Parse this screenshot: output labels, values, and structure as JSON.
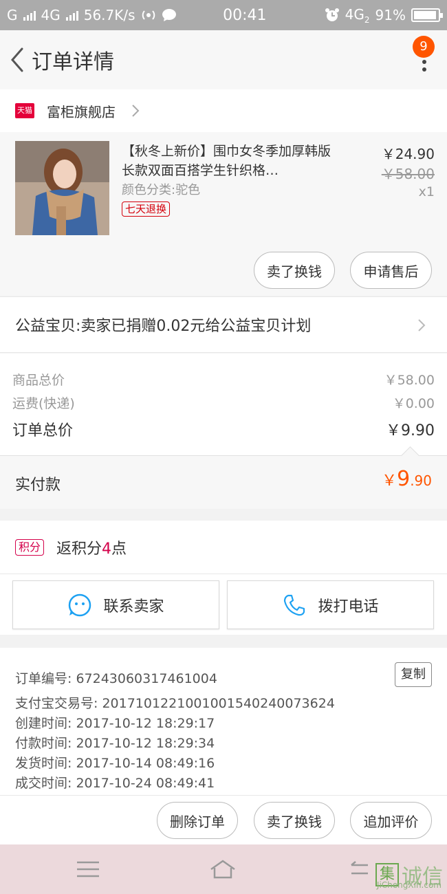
{
  "status_bar": {
    "left": "G",
    "network": "4G",
    "speed": "56.7K/s",
    "time": "00:41",
    "right_network": "4G",
    "right_network_sub": "2",
    "battery": "91%"
  },
  "header": {
    "title": "订单详情",
    "badge": "9"
  },
  "shop": {
    "platform_tag": "天猫",
    "name": "富柜旗舰店"
  },
  "item": {
    "title": "【秋冬上新价】围巾女冬季加厚韩版长款双面百搭学生针织格…",
    "sku": "颜色分类:驼色",
    "tag": "七天退换",
    "price": "￥24.90",
    "original_price": "￥58.00",
    "quantity": "x1",
    "buttons": {
      "sell": "卖了换钱",
      "after_sale": "申请售后"
    }
  },
  "charity": {
    "text": "公益宝贝:卖家已捐赠0.02元给公益宝贝计划"
  },
  "summary": {
    "goods_label": "商品总价",
    "goods_value": "￥58.00",
    "shipping_label": "运费(快递)",
    "shipping_value": "￥0.00",
    "total_label": "订单总价",
    "total_value": "￥9.90",
    "paid_label": "实付款",
    "paid_currency": "￥",
    "paid_int": "9",
    "paid_dec": ".90"
  },
  "points": {
    "tag": "积分",
    "prefix": "返积分",
    "num": "4",
    "suffix": "点"
  },
  "contact": {
    "seller": "联系卖家",
    "phone": "拨打电话"
  },
  "order_info": {
    "order_no": "订单编号: 67243060317461004",
    "alipay_no": "支付宝交易号: 2017101221001001540240073624",
    "created": "创建时间: 2017-10-12 18:29:17",
    "paid": "付款时间: 2017-10-12 18:29:34",
    "shipped": "发货时间: 2017-10-14 08:49:16",
    "closed": "成交时间: 2017-10-24 08:49:41",
    "copy": "复制"
  },
  "actions": {
    "delete": "删除订单",
    "sell": "卖了换钱",
    "review": "追加评价"
  },
  "watermark": {
    "box": "集",
    "text": "诚信",
    "url": "JiChengXin.com"
  }
}
